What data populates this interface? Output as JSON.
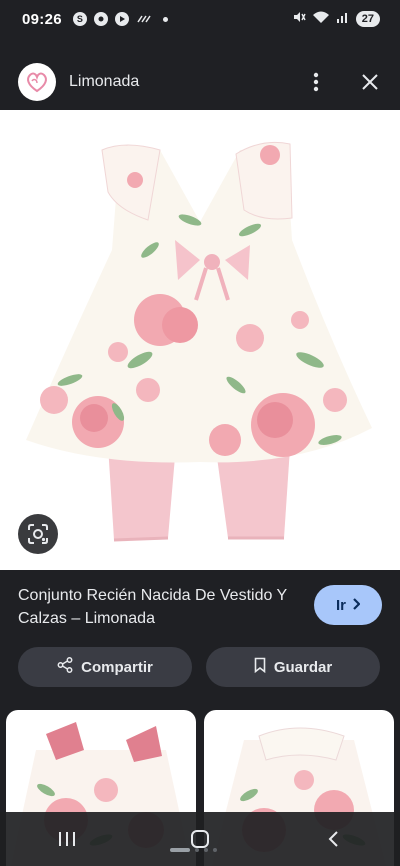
{
  "status_bar": {
    "time": "09:26",
    "notif_s": "S",
    "battery": "27"
  },
  "header": {
    "site_name": "Limonada"
  },
  "colors": {
    "accent_button": "#a8c7fa",
    "background": "#1f2024",
    "action_button": "#3a3c44",
    "dress_pink": "#f2a9b1",
    "leggings_pink": "#f4c6cd"
  },
  "icons": [
    "limonada-logo-icon",
    "more-vert-icon",
    "close-icon",
    "lens-icon",
    "chevron-right-icon",
    "share-icon",
    "bookmark-icon",
    "recents-icon",
    "home-icon",
    "back-icon"
  ],
  "result": {
    "title": "Conjunto Recién Nacida De Vestido Y Calzas – Limonada",
    "go_label": "Ir"
  },
  "actions": {
    "share_label": "Compartir",
    "save_label": "Guardar"
  }
}
